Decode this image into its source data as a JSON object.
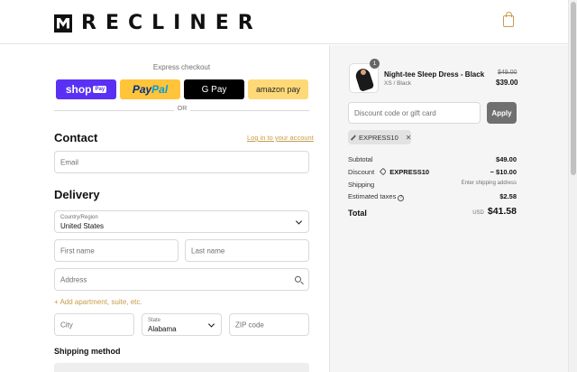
{
  "header": {
    "brand": "RECLINER",
    "cart_icon": "shopping-bag-icon",
    "accent_color": "#c99b4a"
  },
  "checkout": {
    "express_title": "Express checkout",
    "payment_buttons": {
      "shop_pay": "shop",
      "shop_pay_badge": "Pay",
      "paypal_a": "Pay",
      "paypal_b": "Pal",
      "google_pay": "G Pay",
      "amazon_pay": "amazon pay"
    },
    "divider": "OR",
    "contact": {
      "title": "Contact",
      "login_link": "Log in to your account",
      "email_placeholder": "Email"
    },
    "delivery": {
      "title": "Delivery",
      "country_label": "Country/Region",
      "country_value": "United States",
      "first_name_placeholder": "First name",
      "last_name_placeholder": "Last name",
      "address_placeholder": "Address",
      "add_apartment": "+ Add apartment, suite, etc.",
      "city_placeholder": "City",
      "state_label": "State",
      "state_value": "Alabama",
      "zip_placeholder": "ZIP code"
    },
    "shipping_method_title": "Shipping method"
  },
  "summary": {
    "product": {
      "quantity": "1",
      "name": "Night-tee Sleep Dress - Black",
      "variant": "XS / Black",
      "original_price": "$49.00",
      "price": "$39.00"
    },
    "discount_placeholder": "Discount code or gift card",
    "apply_label": "Apply",
    "applied_code": "EXPRESS10",
    "subtotal_label": "Subtotal",
    "subtotal_value": "$49.00",
    "discount_label": "Discount",
    "discount_code": "EXPRESS10",
    "discount_value": "− $10.00",
    "shipping_label": "Shipping",
    "shipping_value": "Enter shipping address",
    "taxes_label": "Estimated taxes",
    "taxes_value": "$2.58",
    "total_label": "Total",
    "currency": "USD",
    "total_value": "$41.58"
  }
}
